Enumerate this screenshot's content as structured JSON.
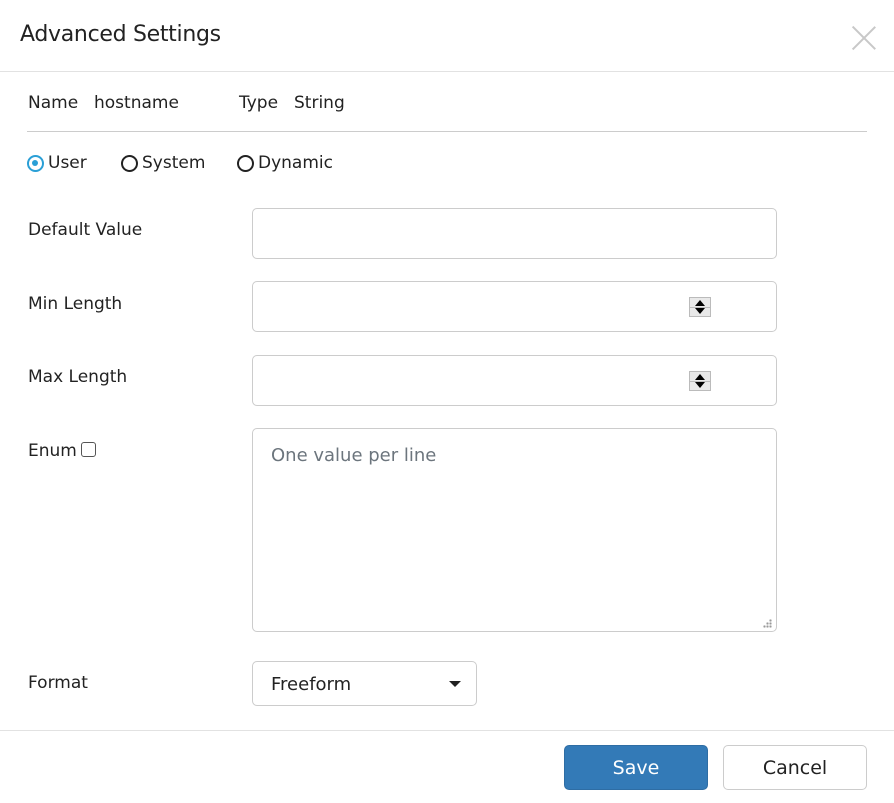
{
  "dialog": {
    "title": "Advanced Settings",
    "close_icon": "close-x-icon"
  },
  "info": {
    "name_label": "Name",
    "name_value": "hostname",
    "type_label": "Type",
    "type_value": "String"
  },
  "scope": {
    "options": [
      {
        "label": "User",
        "checked": true
      },
      {
        "label": "System",
        "checked": false
      },
      {
        "label": "Dynamic",
        "checked": false
      }
    ]
  },
  "fields": {
    "default_value": {
      "label": "Default Value",
      "value": ""
    },
    "min_length": {
      "label": "Min Length",
      "value": ""
    },
    "max_length": {
      "label": "Max Length",
      "value": ""
    },
    "enum": {
      "label": "Enum",
      "checked": false,
      "placeholder": "One value per line",
      "value": ""
    },
    "format": {
      "label": "Format",
      "selected": "Freeform"
    }
  },
  "footer": {
    "save_label": "Save",
    "cancel_label": "Cancel"
  },
  "colors": {
    "primary": "#337ab7",
    "radio_accent": "#2a9fd6"
  }
}
